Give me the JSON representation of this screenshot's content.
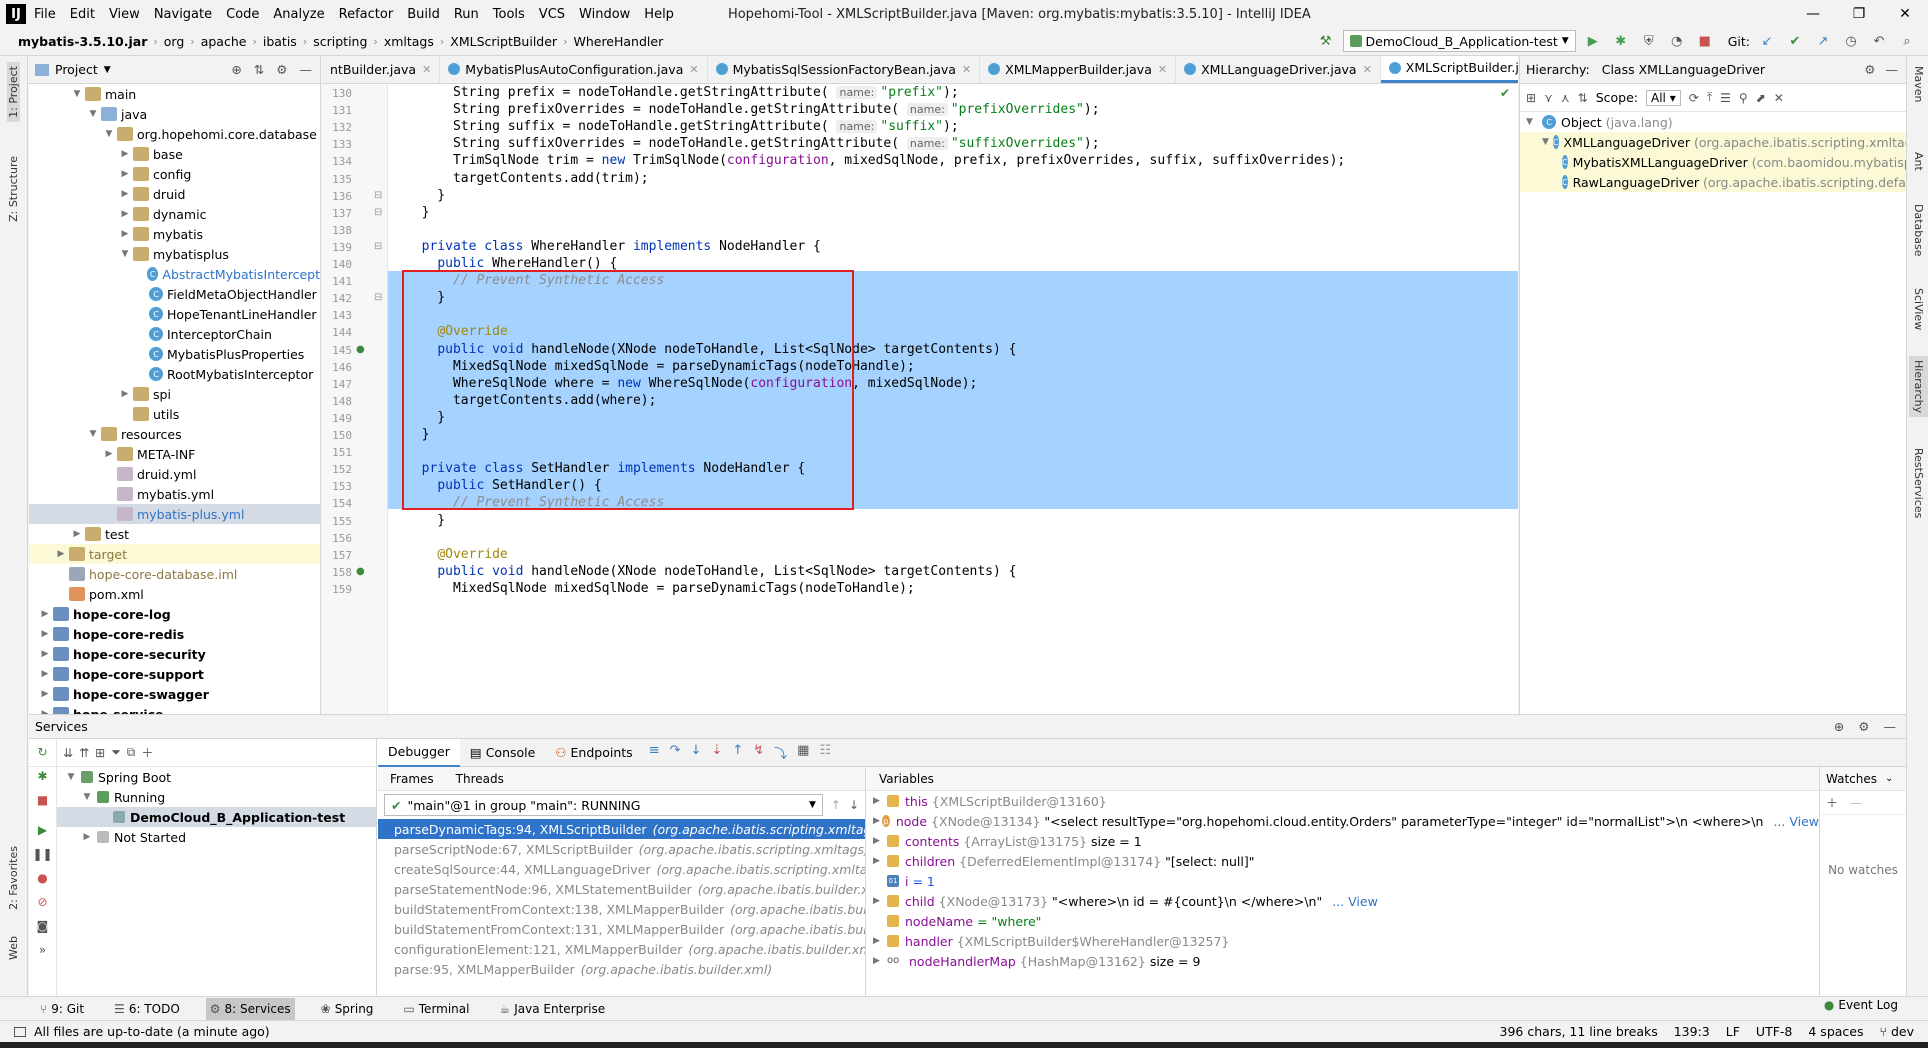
{
  "app": {
    "title": "Hopehomi-Tool - XMLScriptBuilder.java [Maven: org.mybatis:mybatis:3.5.10] - IntelliJ IDEA",
    "logo": "IJ",
    "menu": [
      "File",
      "Edit",
      "View",
      "Navigate",
      "Code",
      "Analyze",
      "Refactor",
      "Build",
      "Run",
      "Tools",
      "VCS",
      "Window",
      "Help"
    ],
    "window_buttons": [
      "—",
      "❐",
      "✕"
    ]
  },
  "breadcrumbs": [
    "mybatis-3.5.10.jar",
    "org",
    "apache",
    "ibatis",
    "scripting",
    "xmltags",
    "XMLScriptBuilder",
    "WhereHandler"
  ],
  "run_config": "DemoCloud_B_Application-test",
  "git_label": "Git:",
  "left_stripe": [
    "1: Project",
    "Z: Structure",
    "2: Favorites",
    "Web"
  ],
  "right_stripe": [
    "Maven",
    "Ant",
    "Database",
    "SciView",
    "Hierarchy",
    "RestServices"
  ],
  "project": {
    "header": "Project",
    "items": [
      {
        "label": "main",
        "depth": 2,
        "kind": "folder",
        "arrow": "▼"
      },
      {
        "label": "java",
        "depth": 3,
        "kind": "folder-blue",
        "arrow": "▼"
      },
      {
        "label": "org.hopehomi.core.database",
        "depth": 4,
        "kind": "folder",
        "arrow": "▼"
      },
      {
        "label": "base",
        "depth": 5,
        "kind": "folder",
        "arrow": "▶"
      },
      {
        "label": "config",
        "depth": 5,
        "kind": "folder",
        "arrow": "▶"
      },
      {
        "label": "druid",
        "depth": 5,
        "kind": "folder",
        "arrow": "▶"
      },
      {
        "label": "dynamic",
        "depth": 5,
        "kind": "folder",
        "arrow": "▶"
      },
      {
        "label": "mybatis",
        "depth": 5,
        "kind": "folder",
        "arrow": "▶"
      },
      {
        "label": "mybatisplus",
        "depth": 5,
        "kind": "folder",
        "arrow": "▼"
      },
      {
        "label": "AbstractMybatisIntercept",
        "depth": 6,
        "kind": "class-link"
      },
      {
        "label": "FieldMetaObjectHandler",
        "depth": 6,
        "kind": "class"
      },
      {
        "label": "HopeTenantLineHandler",
        "depth": 6,
        "kind": "class"
      },
      {
        "label": "InterceptorChain",
        "depth": 6,
        "kind": "class"
      },
      {
        "label": "MybatisPlusProperties",
        "depth": 6,
        "kind": "class"
      },
      {
        "label": "RootMybatisInterceptor",
        "depth": 6,
        "kind": "class"
      },
      {
        "label": "spi",
        "depth": 5,
        "kind": "folder",
        "arrow": "▶"
      },
      {
        "label": "utils",
        "depth": 5,
        "kind": "folder",
        "arrow": ""
      },
      {
        "label": "resources",
        "depth": 3,
        "kind": "folder",
        "arrow": "▼"
      },
      {
        "label": "META-INF",
        "depth": 4,
        "kind": "folder",
        "arrow": "▶"
      },
      {
        "label": "druid.yml",
        "depth": 4,
        "kind": "yml"
      },
      {
        "label": "mybatis.yml",
        "depth": 4,
        "kind": "yml"
      },
      {
        "label": "mybatis-plus.yml",
        "depth": 4,
        "kind": "yml",
        "selected": true
      },
      {
        "label": "test",
        "depth": 2,
        "kind": "folder",
        "arrow": "▶"
      },
      {
        "label": "target",
        "depth": 1,
        "kind": "folder",
        "arrow": "▶",
        "target": true
      },
      {
        "label": "hope-core-database.iml",
        "depth": 1,
        "kind": "iml"
      },
      {
        "label": "pom.xml",
        "depth": 1,
        "kind": "xml"
      },
      {
        "label": "hope-core-log",
        "depth": 0,
        "kind": "folder-bold",
        "arrow": "▶",
        "bold": true
      },
      {
        "label": "hope-core-redis",
        "depth": 0,
        "kind": "folder-bold",
        "arrow": "▶",
        "bold": true
      },
      {
        "label": "hope-core-security",
        "depth": 0,
        "kind": "folder-bold",
        "arrow": "▶",
        "bold": true
      },
      {
        "label": "hope-core-support",
        "depth": 0,
        "kind": "folder-bold",
        "arrow": "▶",
        "bold": true
      },
      {
        "label": "hope-core-swagger",
        "depth": 0,
        "kind": "folder-bold",
        "arrow": "▶",
        "bold": true
      },
      {
        "label": "hope-service",
        "depth": 0,
        "kind": "folder-bold",
        "arrow": "▶",
        "bold": true
      }
    ]
  },
  "editor": {
    "tabs": [
      {
        "label": "ntBuilder.java",
        "active": false
      },
      {
        "label": "MybatisPlusAutoConfiguration.java",
        "active": false
      },
      {
        "label": "MybatisSqlSessionFactoryBean.java",
        "active": false
      },
      {
        "label": "XMLMapperBuilder.java",
        "active": false
      },
      {
        "label": "XMLLanguageDriver.java",
        "active": false
      },
      {
        "label": "XMLScriptBuilder.java",
        "active": true
      }
    ],
    "lines": [
      {
        "n": "130",
        "t": [
          [
            "      String prefix = nodeToHandle.getStringAttribute( ",
            ""
          ],
          [
            "name:",
            "hint"
          ],
          [
            "\"prefix\"",
            "str"
          ],
          [
            ");",
            ""
          ]
        ]
      },
      {
        "n": "131",
        "t": [
          [
            "      String prefixOverrides = nodeToHandle.getStringAttribute( ",
            ""
          ],
          [
            "name:",
            "hint"
          ],
          [
            "\"prefixOverrides\"",
            "str"
          ],
          [
            ");",
            ""
          ]
        ]
      },
      {
        "n": "132",
        "t": [
          [
            "      String suffix = nodeToHandle.getStringAttribute( ",
            ""
          ],
          [
            "name:",
            "hint"
          ],
          [
            "\"suffix\"",
            "str"
          ],
          [
            ");",
            ""
          ]
        ]
      },
      {
        "n": "133",
        "t": [
          [
            "      String suffixOverrides = nodeToHandle.getStringAttribute( ",
            ""
          ],
          [
            "name:",
            "hint"
          ],
          [
            "\"suffixOverrides\"",
            "str"
          ],
          [
            ");",
            ""
          ]
        ]
      },
      {
        "n": "134",
        "t": [
          [
            "      TrimSqlNode trim = ",
            ""
          ],
          [
            "new",
            "kw"
          ],
          [
            " TrimSqlNode(",
            ""
          ],
          [
            "configuration",
            "fld"
          ],
          [
            ", mixedSqlNode, prefix, prefixOverrides, suffix, suffixOverrides);",
            ""
          ]
        ]
      },
      {
        "n": "135",
        "t": [
          [
            "      targetContents.add(trim);",
            ""
          ]
        ]
      },
      {
        "n": "136",
        "t": [
          [
            "    }",
            ""
          ]
        ]
      },
      {
        "n": "137",
        "t": [
          [
            "  }",
            ""
          ]
        ]
      },
      {
        "n": "138",
        "t": []
      },
      {
        "n": "139",
        "t": [
          [
            "  ",
            ""
          ],
          [
            "private class",
            "kw"
          ],
          [
            " WhereHandler ",
            ""
          ],
          [
            "implements",
            "kw"
          ],
          [
            " NodeHandler {",
            ""
          ]
        ]
      },
      {
        "n": "140",
        "t": [
          [
            "    ",
            ""
          ],
          [
            "public",
            "kw"
          ],
          [
            " WhereHandler() {",
            ""
          ]
        ]
      },
      {
        "n": "141",
        "t": [
          [
            "      // Prevent Synthetic Access",
            "cm"
          ]
        ]
      },
      {
        "n": "142",
        "t": [
          [
            "    }",
            ""
          ]
        ]
      },
      {
        "n": "143",
        "t": []
      },
      {
        "n": "144",
        "t": [
          [
            "    ",
            ""
          ],
          [
            "@Override",
            "ann"
          ]
        ]
      },
      {
        "n": "145",
        "t": [
          [
            "    ",
            ""
          ],
          [
            "public void",
            "kw"
          ],
          [
            " handleNode(XNode nodeToHandle, List<SqlNode> targetContents) {",
            ""
          ]
        ]
      },
      {
        "n": "146",
        "t": [
          [
            "      MixedSqlNode mixedSqlNode = parseDynamicTags(nodeToHandle);",
            ""
          ]
        ]
      },
      {
        "n": "147",
        "t": [
          [
            "      WhereSqlNode where = ",
            ""
          ],
          [
            "new",
            "kw"
          ],
          [
            " WhereSqlNode(",
            ""
          ],
          [
            "configuration",
            "fld"
          ],
          [
            ", mixedSqlNode);",
            ""
          ]
        ]
      },
      {
        "n": "148",
        "t": [
          [
            "      targetContents.add(where);",
            ""
          ]
        ]
      },
      {
        "n": "149",
        "t": [
          [
            "    }",
            ""
          ]
        ]
      },
      {
        "n": "150",
        "t": [
          [
            "  }",
            ""
          ]
        ]
      },
      {
        "n": "151",
        "t": []
      },
      {
        "n": "152",
        "t": [
          [
            "  ",
            ""
          ],
          [
            "private class",
            "kw"
          ],
          [
            " SetHandler ",
            ""
          ],
          [
            "implements",
            "kw"
          ],
          [
            " NodeHandler {",
            ""
          ]
        ]
      },
      {
        "n": "153",
        "t": [
          [
            "    ",
            ""
          ],
          [
            "public",
            "kw"
          ],
          [
            " SetHandler() {",
            ""
          ]
        ]
      },
      {
        "n": "154",
        "t": [
          [
            "      // Prevent Synthetic Access",
            "cm"
          ]
        ]
      },
      {
        "n": "155",
        "t": [
          [
            "    }",
            ""
          ]
        ]
      },
      {
        "n": "156",
        "t": []
      },
      {
        "n": "157",
        "t": [
          [
            "    ",
            ""
          ],
          [
            "@Override",
            "ann"
          ]
        ]
      },
      {
        "n": "158",
        "t": [
          [
            "    ",
            ""
          ],
          [
            "public void",
            "kw"
          ],
          [
            " handleNode(XNode nodeToHandle, List<SqlNode> targetContents) {",
            ""
          ]
        ]
      },
      {
        "n": "159",
        "t": [
          [
            "      MixedSqlNode mixedSqlNode = parseDynamicTags(nodeToHandle);",
            ""
          ]
        ]
      }
    ]
  },
  "hierarchy": {
    "header": "Hierarchy:",
    "title": "Class XMLLanguageDriver",
    "scope_label": "Scope:",
    "scope_value": "All",
    "items": [
      {
        "name": "Object",
        "pkg": "(java.lang)",
        "depth": 0
      },
      {
        "name": "XMLLanguageDriver",
        "pkg": "(org.apache.ibatis.scripting.xmltags)",
        "depth": 1
      },
      {
        "name": "MybatisXMLLanguageDriver",
        "pkg": "(com.baomidou.mybatisplus.core)",
        "depth": 2
      },
      {
        "name": "RawLanguageDriver",
        "pkg": "(org.apache.ibatis.scripting.defaults)",
        "depth": 2
      }
    ]
  },
  "services": {
    "header": "Services",
    "tree": [
      {
        "label": "Spring Boot",
        "depth": 0,
        "arrow": "▼"
      },
      {
        "label": "Running",
        "depth": 1,
        "arrow": "▼"
      },
      {
        "label": "DemoCloud_B_Application-test",
        "depth": 2,
        "arrow": "",
        "bold": true,
        "selected": true
      },
      {
        "label": "Not Started",
        "depth": 1,
        "arrow": "▶"
      }
    ],
    "debug_tabs": [
      "Debugger",
      "Console",
      "Endpoints"
    ],
    "frames_tab": "Frames",
    "threads_tab": "Threads",
    "thread_selector": "\"main\"@1 in group \"main\": RUNNING",
    "frames": [
      {
        "m": "parseDynamicTags:94, XMLScriptBuilder",
        "p": "(org.apache.ibatis.scripting.xmltags)",
        "selected": true
      },
      {
        "m": "parseScriptNode:67, XMLScriptBuilder",
        "p": "(org.apache.ibatis.scripting.xmltags)"
      },
      {
        "m": "createSqlSource:44, XMLLanguageDriver",
        "p": "(org.apache.ibatis.scripting.xmltags)"
      },
      {
        "m": "parseStatementNode:96, XMLStatementBuilder",
        "p": "(org.apache.ibatis.builder.xml)"
      },
      {
        "m": "buildStatementFromContext:138, XMLMapperBuilder",
        "p": "(org.apache.ibatis.builder.xml)"
      },
      {
        "m": "buildStatementFromContext:131, XMLMapperBuilder",
        "p": "(org.apache.ibatis.builder.xml)"
      },
      {
        "m": "configurationElement:121, XMLMapperBuilder",
        "p": "(org.apache.ibatis.builder.xml)"
      },
      {
        "m": "parse:95, XMLMapperBuilder",
        "p": "(org.apache.ibatis.builder.xml)"
      }
    ],
    "variables_header": "Variables",
    "variables": [
      {
        "arrow": "▶",
        "icon": "f",
        "name": "this",
        "val": "{XMLScriptBuilder@13160}",
        "extra": ""
      },
      {
        "arrow": "▶",
        "icon": "p",
        "name": "node",
        "val": "{XNode@13134}",
        "extra": "\"<select resultType=\"org.hopehomi.cloud.entity.Orders\" parameterType=\"integer\" id=\"normalList\">\\n     <where>\\n",
        "link": "... View"
      },
      {
        "arrow": "▶",
        "icon": "f",
        "name": "contents",
        "val": "{ArrayList@13175}",
        "extra": "size = 1"
      },
      {
        "arrow": "▶",
        "icon": "f",
        "name": "children",
        "val": "{DeferredElementImpl@13174}",
        "extra": "\"[select: null]\""
      },
      {
        "arrow": "",
        "icon": "pr",
        "name": "i",
        "val": "= 1",
        "extra": ""
      },
      {
        "arrow": "▶",
        "icon": "f",
        "name": "child",
        "val": "{XNode@13173}",
        "extra": "\"<where>\\n            id = #{count}\\n        </where>\\n\"",
        "link": "... View"
      },
      {
        "arrow": "",
        "icon": "f",
        "name": "nodeName",
        "val": "= \"where\"",
        "extra": ""
      },
      {
        "arrow": "▶",
        "icon": "f",
        "name": "handler",
        "val": "{XMLScriptBuilder$WhereHandler@13257}",
        "extra": ""
      },
      {
        "arrow": "▶",
        "icon": "oo",
        "name": "nodeHandlerMap",
        "val": "{HashMap@13162}",
        "extra": "size = 9"
      }
    ],
    "watches_header": "Watches",
    "no_watches": "No watches"
  },
  "bottom_tools": [
    {
      "label": "9: Git",
      "active": false
    },
    {
      "label": "6: TODO",
      "active": false
    },
    {
      "label": "8: Services",
      "active": true
    },
    {
      "label": "Spring",
      "active": false
    },
    {
      "label": "Terminal",
      "active": false
    },
    {
      "label": "Java Enterprise",
      "active": false
    }
  ],
  "event_log": "Event Log",
  "status": {
    "message": "All files are up-to-date (a minute ago)",
    "chars": "396 chars, 11 line breaks",
    "position": "139:3",
    "line_sep": "LF",
    "encoding": "UTF-8",
    "indent": "4 spaces",
    "branch": "dev"
  }
}
